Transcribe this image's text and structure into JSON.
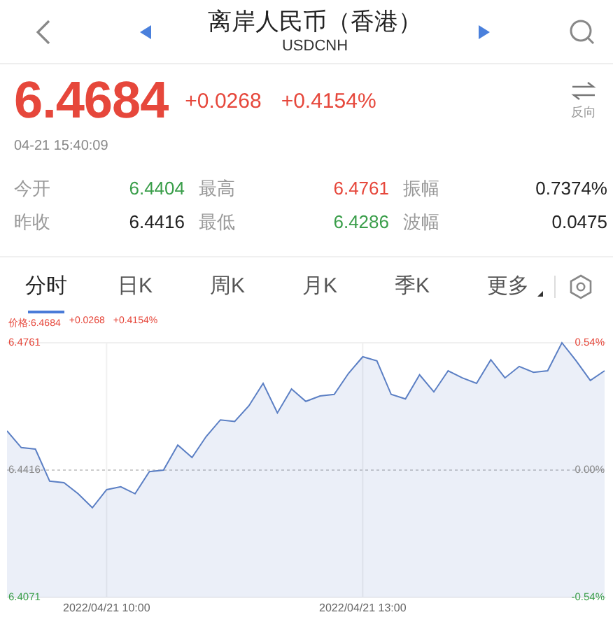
{
  "header": {
    "title": "离岸人民币（香港）",
    "subtitle": "USDCNH"
  },
  "quote": {
    "price": "6.4684",
    "change": "+0.0268",
    "percent": "+0.4154%",
    "swap_label": "反向",
    "timestamp": "04-21 15:40:09"
  },
  "stats": [
    {
      "label": "今开",
      "value": "6.4404",
      "color": "#3a9e4a"
    },
    {
      "label": "最高",
      "value": "6.4761",
      "color": "#e6473b"
    },
    {
      "label": "振幅",
      "value": "0.7374%",
      "color": "#222222"
    },
    {
      "label": "昨收",
      "value": "6.4416",
      "color": "#222222"
    },
    {
      "label": "最低",
      "value": "6.4286",
      "color": "#3a9e4a"
    },
    {
      "label": "波幅",
      "value": "0.0475",
      "color": "#222222"
    }
  ],
  "tabs": [
    {
      "label": "分时",
      "selected": true,
      "kind": "plain"
    },
    {
      "label": "日K",
      "selected": false,
      "kind": "plain"
    },
    {
      "label": "周K",
      "selected": false,
      "kind": "plain"
    },
    {
      "label": "月K",
      "selected": false,
      "kind": "plain"
    },
    {
      "label": "季K",
      "selected": false,
      "kind": "plain"
    },
    {
      "label": "更多",
      "selected": false,
      "kind": "dropdown"
    }
  ],
  "chart": {
    "legend": [
      "价格:6.4684",
      "+0.0268",
      "+0.4154%"
    ],
    "right_labels": [
      {
        "text": "0.54%",
        "color": "#e6473b"
      },
      {
        "text": "0.00%",
        "color": "#888888"
      },
      {
        "text": "-0.54%",
        "color": "#3a9e4a"
      }
    ],
    "chart_data": {
      "type": "area",
      "ylim": [
        6.4071,
        6.4761
      ],
      "ref_lines": [
        {
          "axis": "y",
          "value": 6.4416
        }
      ],
      "yticks": [
        {
          "value": 6.4761,
          "label": "6.4761"
        },
        {
          "value": 6.4416,
          "label": "6.4416"
        },
        {
          "value": 6.4071,
          "label": "6.4071"
        }
      ],
      "categories": [
        null,
        null,
        null,
        null,
        null,
        null,
        null,
        "2022/04/21 10:00",
        null,
        null,
        null,
        null,
        null,
        null,
        null,
        null,
        null,
        null,
        null,
        null,
        null,
        null,
        null,
        null,
        null,
        "2022/04/21 13:00",
        null,
        null,
        null,
        null,
        null,
        null,
        null,
        null,
        null,
        null,
        null,
        null,
        null,
        null,
        null,
        null,
        null
      ],
      "series": [
        {
          "color": "#5b7fc4",
          "values": [
            6.4522,
            6.4477,
            6.4473,
            6.4386,
            6.4382,
            6.4352,
            6.4314,
            6.4363,
            6.4371,
            6.4352,
            6.4412,
            6.4416,
            6.4484,
            6.445,
            6.4507,
            6.4552,
            6.4548,
            6.459,
            6.4651,
            6.4571,
            6.4636,
            6.4602,
            6.4617,
            6.4621,
            6.4678,
            6.4723,
            6.4712,
            6.4621,
            6.4609,
            6.4674,
            6.4628,
            6.4685,
            6.4666,
            6.4651,
            6.4715,
            6.4666,
            6.4697,
            6.4681,
            6.4685,
            6.4761,
            6.4712,
            6.4659,
            6.4685
          ]
        }
      ]
    }
  }
}
